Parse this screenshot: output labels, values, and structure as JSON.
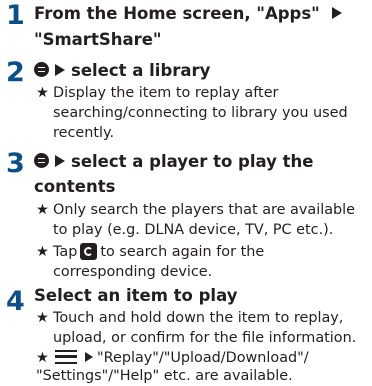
{
  "accent_color": "#0b4f8a",
  "steps": [
    {
      "number": "1",
      "heading_lines": [
        "From the Home screen, \"Apps\"",
        "\"SmartShare\""
      ]
    },
    {
      "number": "2",
      "heading_text": "select a library",
      "notes": [
        {
          "star": "★",
          "lines": [
            "Display the item to replay after",
            "searching/connecting to library you used",
            "recently."
          ]
        }
      ]
    },
    {
      "number": "3",
      "heading_lines": [
        "select a player to play the",
        "contents"
      ],
      "notes": [
        {
          "star": "★",
          "lines": [
            "Only search the players that are available",
            "to play (e.g. DLNA device, TV, PC etc.)."
          ]
        },
        {
          "star": "★",
          "tap": "Tap",
          "after_icon": "to search again for the",
          "line2": "corresponding device."
        }
      ]
    },
    {
      "number": "4",
      "heading_text": "Select an item to play",
      "notes": [
        {
          "star": "★",
          "lines": [
            "Touch and hold down the item to replay,",
            "upload, or confirm for the file information."
          ]
        },
        {
          "star": "★",
          "after_icon": "\"Replay\"/\"Upload/Download\"/",
          "line2": "\"Settings\"/\"Help\" etc. are available."
        }
      ]
    }
  ],
  "icons": {
    "step2": "library-icon",
    "step3": "player-icon",
    "step3_note2": "refresh-icon",
    "step4_note2": "menu-icon",
    "arrow": "right-triangle-icon"
  }
}
